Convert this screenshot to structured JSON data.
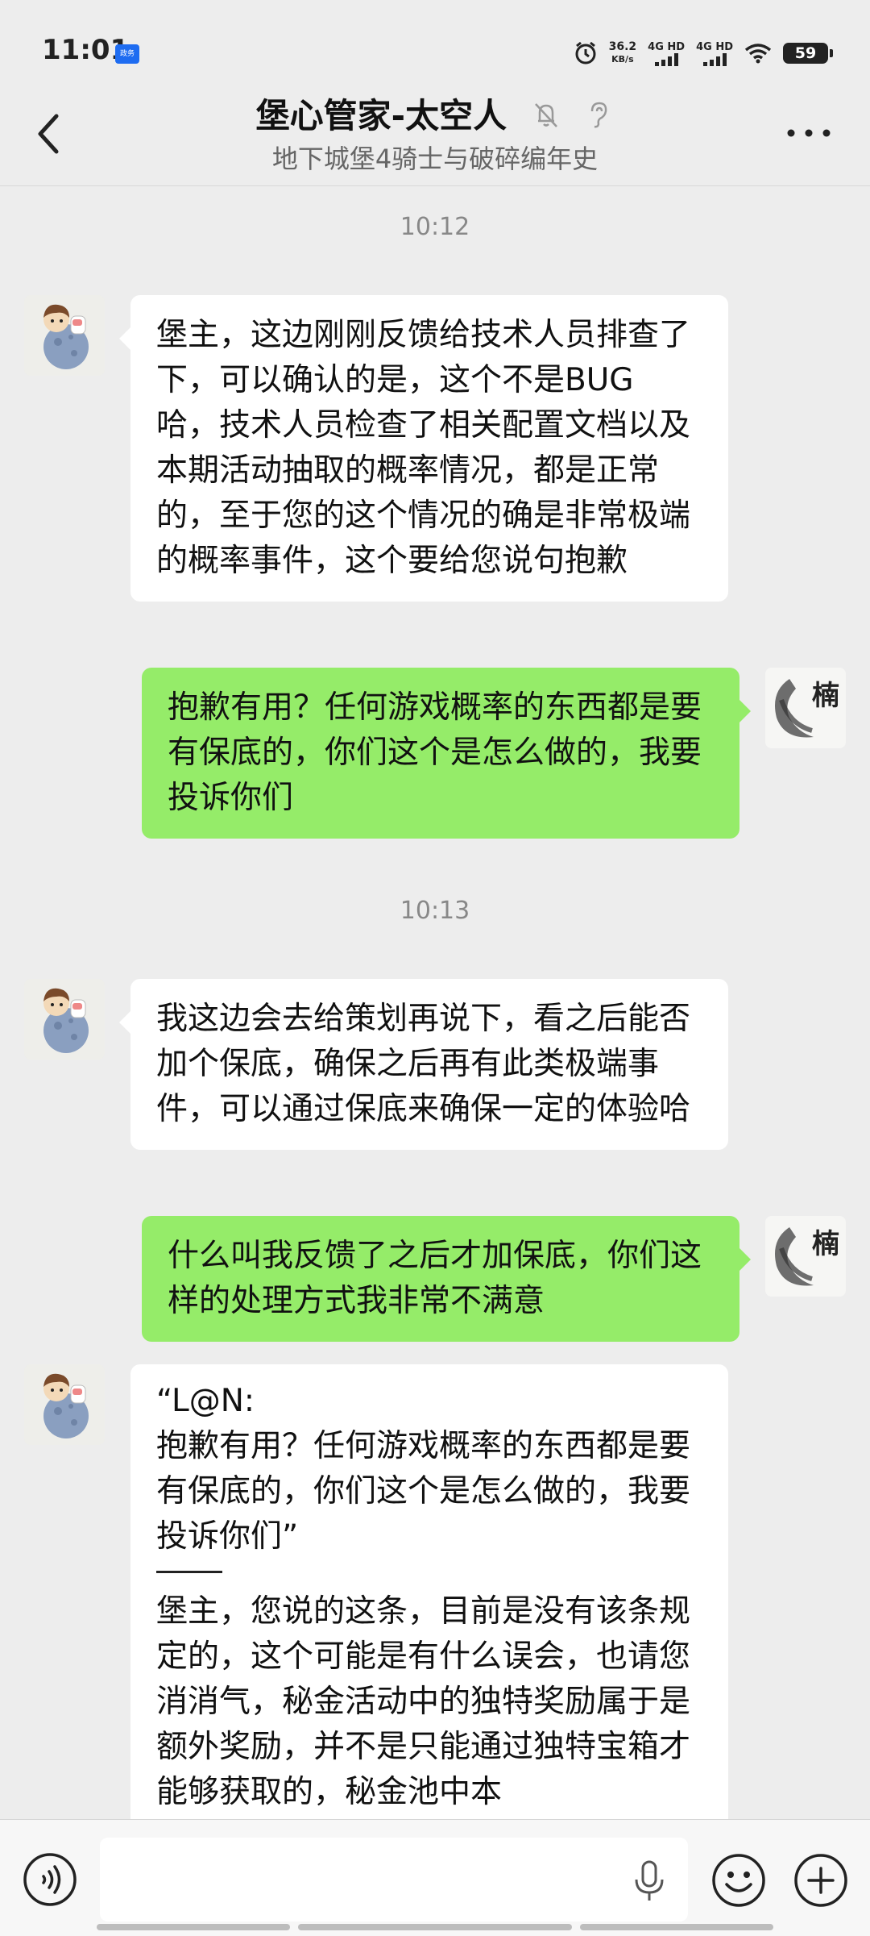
{
  "status_bar": {
    "time": "11:01",
    "badge": "政务",
    "speed_value": "36.2",
    "speed_unit": "KB/s",
    "net1": "4G HD",
    "net2": "4G HD",
    "battery": "59"
  },
  "header": {
    "title": "堡心管家-太空人",
    "subtitle": "地下城堡4骑士与破碎编年史",
    "icons": [
      "mute-bell-icon",
      "ear-icon"
    ]
  },
  "messages": [
    {
      "type": "time",
      "text": "10:12"
    },
    {
      "type": "msg",
      "side": "left",
      "sender": "堡心管家-太空人",
      "text": "堡主，这边刚刚反馈给技术人员排查了下，可以确认的是，这个不是BUG 哈，技术人员检查了相关配置文档以及本期活动抽取的概率情况，都是正常的，至于您的这个情况的确是非常极端的概率事件，这个要给您说句抱歉"
    },
    {
      "type": "msg",
      "side": "right",
      "text": "抱歉有用？任何游戏概率的东西都是要有保底的，你们这个是怎么做的，我要投诉你们"
    },
    {
      "type": "time",
      "text": "10:13"
    },
    {
      "type": "msg",
      "side": "left",
      "text": "我这边会去给策划再说下，看之后能否加个保底，确保之后再有此类极端事件，可以通过保底来确保一定的体验哈"
    },
    {
      "type": "msg",
      "side": "right",
      "text": "什么叫我反馈了之后才加保底，你们这样的处理方式我非常不满意"
    },
    {
      "type": "msg",
      "side": "left",
      "quote": "“L@N:\n抱歉有用？任何游戏概率的东西都是要有保底的，你们这个是怎么做的，我要投诉你们”",
      "text": "堡主，您说的这条，目前是没有该条规定的，这个可能是有什么误会，也请您消消气，秘金活动中的独特奖励属于是额外奖励，并不是只能通过独特宝箱才能够获取的，秘金池中本"
    }
  ],
  "input_bar": {
    "placeholder": "",
    "icons": [
      "voice-icon",
      "mic-icon",
      "emoji-icon",
      "plus-icon"
    ]
  },
  "colors": {
    "background": "#ededed",
    "bubble_self": "#95ec69",
    "bubble_other": "#ffffff"
  }
}
